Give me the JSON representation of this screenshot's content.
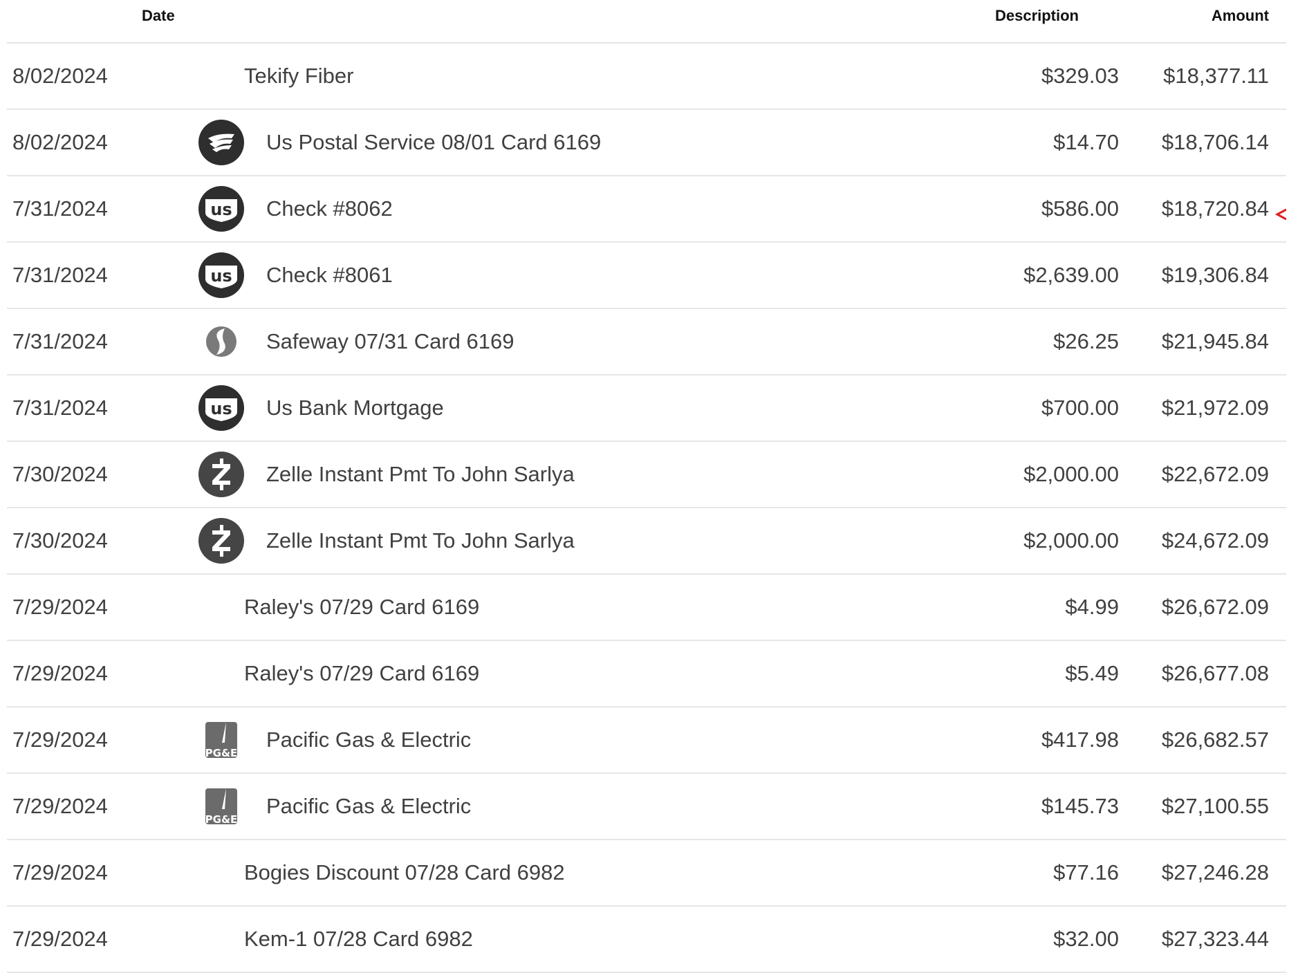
{
  "columns": {
    "date": "Date",
    "description": "Description",
    "amount": "Amount"
  },
  "colors": {
    "text": "#404040",
    "header_text": "#111111",
    "divider": "#e6e6e6",
    "logo_dark": "#2e2e2e",
    "indicator": "#e02020"
  },
  "transactions": [
    {
      "date": "8/02/2024",
      "logo": "none",
      "description": "Tekify Fiber",
      "amount": "$329.03",
      "balance": "$18,377.11"
    },
    {
      "date": "8/02/2024",
      "logo": "usps-eagle-icon",
      "description": "Us Postal Service 08/01 Card 6169",
      "amount": "$14.70",
      "balance": "$18,706.14"
    },
    {
      "date": "7/31/2024",
      "logo": "us-bank-icon",
      "description": "Check #8062",
      "amount": "$586.00",
      "balance": "$18,720.84",
      "indicator": "red-arrow-icon"
    },
    {
      "date": "7/31/2024",
      "logo": "us-bank-icon",
      "description": "Check #8061",
      "amount": "$2,639.00",
      "balance": "$19,306.84"
    },
    {
      "date": "7/31/2024",
      "logo": "safeway-icon",
      "description": "Safeway 07/31 Card 6169",
      "amount": "$26.25",
      "balance": "$21,945.84"
    },
    {
      "date": "7/31/2024",
      "logo": "us-bank-icon",
      "description": "Us Bank Mortgage",
      "amount": "$700.00",
      "balance": "$21,972.09"
    },
    {
      "date": "7/30/2024",
      "logo": "zelle-icon",
      "description": "Zelle Instant Pmt To John Sarlya",
      "amount": "$2,000.00",
      "balance": "$22,672.09"
    },
    {
      "date": "7/30/2024",
      "logo": "zelle-icon",
      "description": "Zelle Instant Pmt To John Sarlya",
      "amount": "$2,000.00",
      "balance": "$24,672.09"
    },
    {
      "date": "7/29/2024",
      "logo": "none",
      "description": "Raley's 07/29 Card 6169",
      "amount": "$4.99",
      "balance": "$26,672.09"
    },
    {
      "date": "7/29/2024",
      "logo": "none",
      "description": "Raley's 07/29 Card 6169",
      "amount": "$5.49",
      "balance": "$26,677.08"
    },
    {
      "date": "7/29/2024",
      "logo": "pge-icon",
      "description": "Pacific Gas & Electric",
      "amount": "$417.98",
      "balance": "$26,682.57"
    },
    {
      "date": "7/29/2024",
      "logo": "pge-icon",
      "description": "Pacific Gas & Electric",
      "amount": "$145.73",
      "balance": "$27,100.55"
    },
    {
      "date": "7/29/2024",
      "logo": "none",
      "description": "Bogies Discount 07/28 Card 6982",
      "amount": "$77.16",
      "balance": "$27,246.28"
    },
    {
      "date": "7/29/2024",
      "logo": "none",
      "description": "Kem-1 07/28 Card 6982",
      "amount": "$32.00",
      "balance": "$27,323.44"
    }
  ]
}
